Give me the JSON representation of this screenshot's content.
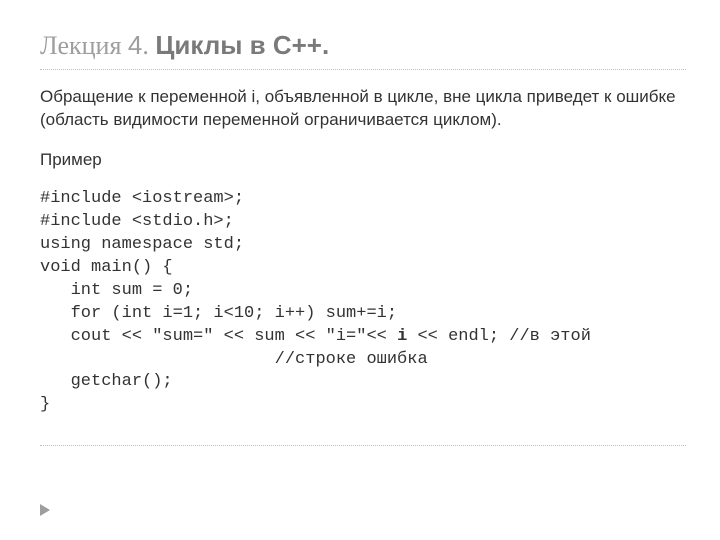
{
  "title": {
    "lecture_prefix": "Лекция",
    "lecture_number": "4",
    "separator": ". ",
    "topic": "Циклы в С++."
  },
  "paragraph": "Обращение к переменной i, объявленной в цикле, вне цикла приведет к ошибке (область видимости переменной ограничивается циклом).",
  "example_label": "Пример",
  "code": {
    "l1": "#include <iostream>;",
    "l2": "#include <stdio.h>;",
    "l3": "using namespace std;",
    "l4": "void main() {",
    "l5a": "   int sum = 0;",
    "l6a": "   for (int i=1; i<10; i++) sum+=i;",
    "l7a": "   cout << \"sum=\" << sum << \"i=\"<< ",
    "l7_bold": "i",
    "l7b": " << endl; //в этой",
    "l8": "                       //строке ошибка",
    "l9": "   getchar();",
    "l10": "}"
  },
  "icons": {
    "bullet": "▶"
  }
}
